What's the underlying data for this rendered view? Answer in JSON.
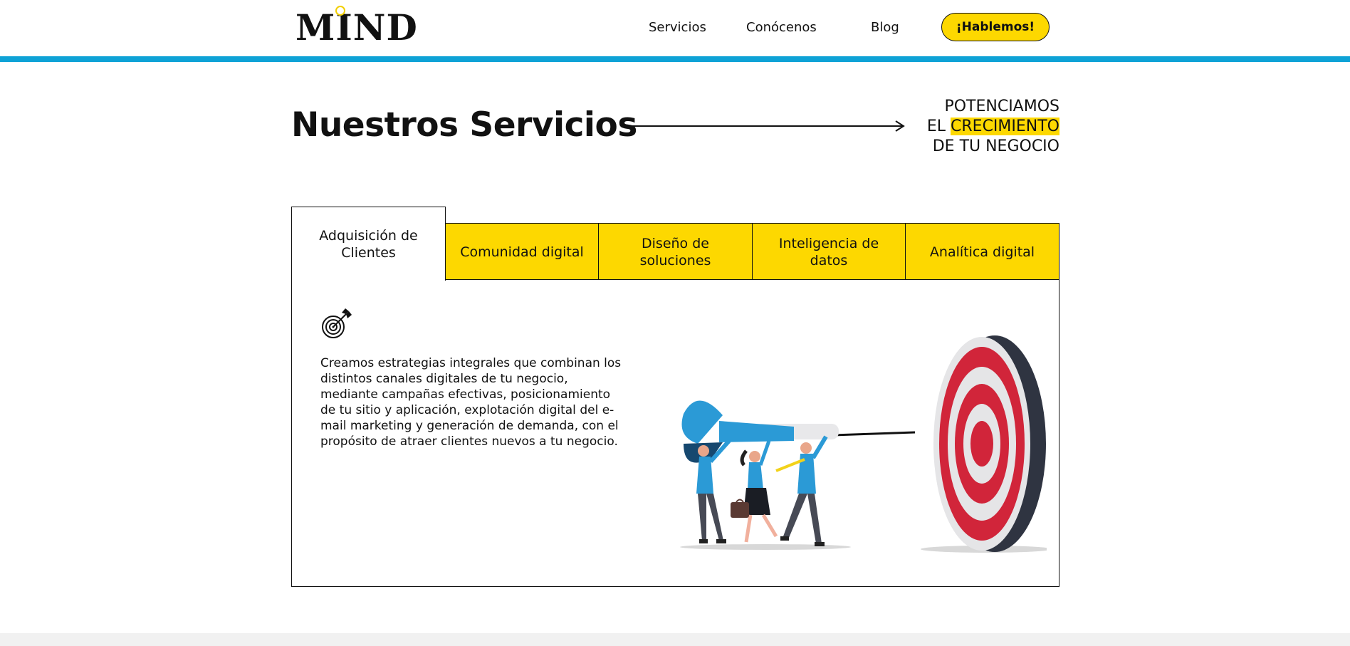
{
  "header": {
    "logo": "MIND",
    "nav": [
      "Servicios",
      "Conócenos",
      "Blog"
    ],
    "cta": "¡Hablemos!",
    "accent_color": "#0ea2d6",
    "brand_yellow": "#fdd800"
  },
  "hero": {
    "title": "Nuestros Servicios",
    "tagline_line1": "POTENCIAMOS",
    "tagline_line2_prefix": "EL ",
    "tagline_highlight": "CRECIMIENTO",
    "tagline_line3": "DE TU NEGOCIO"
  },
  "tabs": [
    {
      "label": "Adquisición de Clientes",
      "active": true
    },
    {
      "label": "Comunidad digital",
      "active": false
    },
    {
      "label": "Diseño de soluciones",
      "active": false
    },
    {
      "label": "Inteligencia de datos",
      "active": false
    },
    {
      "label": "Analítica digital",
      "active": false
    }
  ],
  "panel": {
    "icon": "target-dart-icon",
    "description": "Creamos estrategias integrales que combinan los distintos canales digitales de tu negocio, mediante campañas efectivas, posicionamiento de tu sitio y aplicación, explotación digital del e-mail marketing y generación de demanda, con el propósito de atraer clientes nuevos a tu negocio.",
    "illustration": "team-carrying-dart-to-target-illustration"
  }
}
